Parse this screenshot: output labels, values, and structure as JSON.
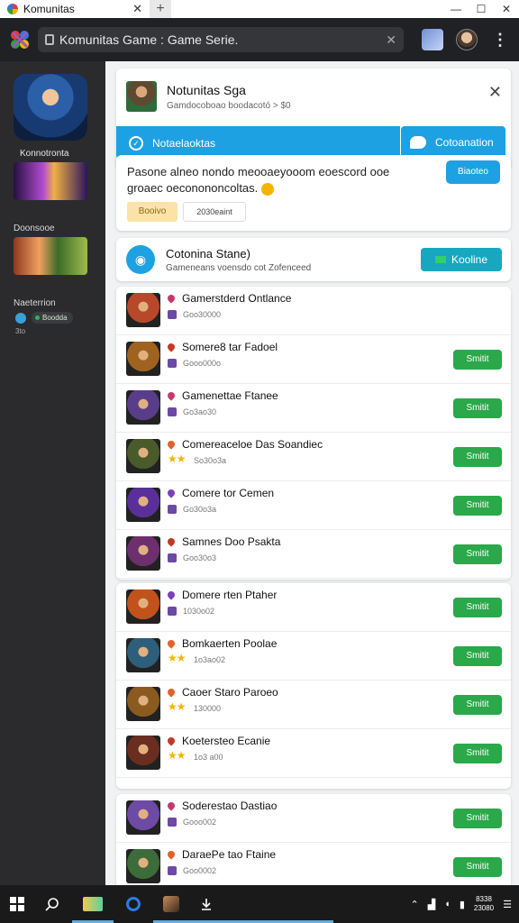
{
  "browser": {
    "tab_title": "Komunitas",
    "new_tab": "+",
    "url": "Komunitas Game : Game Serie.",
    "window_controls": [
      "—",
      "☐",
      "✕"
    ]
  },
  "sidebar": {
    "label1": "Konnotronta",
    "label2": "Doonsooe",
    "label3": "Naeterrion",
    "pill_label": "Boodda",
    "tiny_label": "3to"
  },
  "header": {
    "title": "Notunitas Sga",
    "subtitle": "Gamdocoboao boodacotó > $0",
    "left_button": "Notaelaoktas",
    "right_button": "Cotoanation"
  },
  "promo": {
    "text": "Pasone alneo nondo meooaeyooom eoescord ooe groaec oeconononcoltas.",
    "button": "Biaoteo",
    "chip1": "Booivo",
    "chip2": "2030eaint"
  },
  "online": {
    "title": "Cotonina Stane)",
    "subtitle": "Gameneans voensdo cot Zofenceed",
    "button": "Kooline"
  },
  "games": [
    {
      "name": "Gamerstderd Ontlance",
      "meta": "Goo30000",
      "thumb": "#b8482a",
      "mark": "#c23a6b",
      "rated": false,
      "button": ""
    },
    {
      "name": "Somere8 tar Fadoel",
      "meta": "Gooo000o",
      "thumb": "#a0621f",
      "mark": "#c0392b",
      "rated": false,
      "button": "Smitit"
    },
    {
      "name": "Gamenettae Ftanee",
      "meta": "Go3ao30",
      "thumb": "#5a3d8a",
      "mark": "#c23a6b",
      "rated": false,
      "button": "Smitit"
    },
    {
      "name": "Comereaceloe Das Soandiec",
      "meta": "So30o3a",
      "thumb": "#4a5a2a",
      "mark": "#e0622c",
      "rated": true,
      "button": "Smitit"
    },
    {
      "name": "Comere tor Cemen",
      "meta": "Go30o3a",
      "thumb": "#5b2f9a",
      "mark": "#7b3fb8",
      "rated": false,
      "button": "Smitit"
    },
    {
      "name": "Samnes Doo Psakta",
      "meta": "Goo30o3",
      "thumb": "#6d2f6e",
      "mark": "#c0392b",
      "rated": false,
      "button": "Smitit"
    },
    {
      "name": "Domere rten Ptaher",
      "meta": "1030o02",
      "thumb": "#c2521b",
      "mark": "#7b3fb8",
      "rated": false,
      "button": "Smitit"
    },
    {
      "name": "Bomkaerten Poolae",
      "meta": "1o3ao02",
      "thumb": "#2d5f7a",
      "mark": "#e0622c",
      "rated": true,
      "button": "Smitit"
    },
    {
      "name": "Caoer Staro Paroeo",
      "meta": "130000",
      "thumb": "#8a5a1f",
      "mark": "#e0622c",
      "rated": true,
      "button": "Smitit"
    },
    {
      "name": "Koetersteo Ecanie",
      "meta": "1o3 a00",
      "thumb": "#6a2d1f",
      "mark": "#c0392b",
      "rated": true,
      "button": "Smitit"
    },
    {
      "name": "Soderestao Dastiao",
      "meta": "Gooo002",
      "thumb": "#6d4aa3",
      "mark": "#c23a6b",
      "rated": false,
      "button": "Smitit"
    },
    {
      "name": "DaraePe tao Ftaine",
      "meta": "Goo0002",
      "thumb": "#3d6b3a",
      "mark": "#e0622c",
      "rated": false,
      "button": "Smitit"
    }
  ],
  "taskbar": {
    "clock_time": "8338",
    "clock_date": "23080"
  },
  "colors": {
    "accent_blue": "#1da1e2",
    "action_green": "#2aa84a",
    "sidebar_bg": "#2b2b2e",
    "content_bg": "#f1f2f4"
  }
}
